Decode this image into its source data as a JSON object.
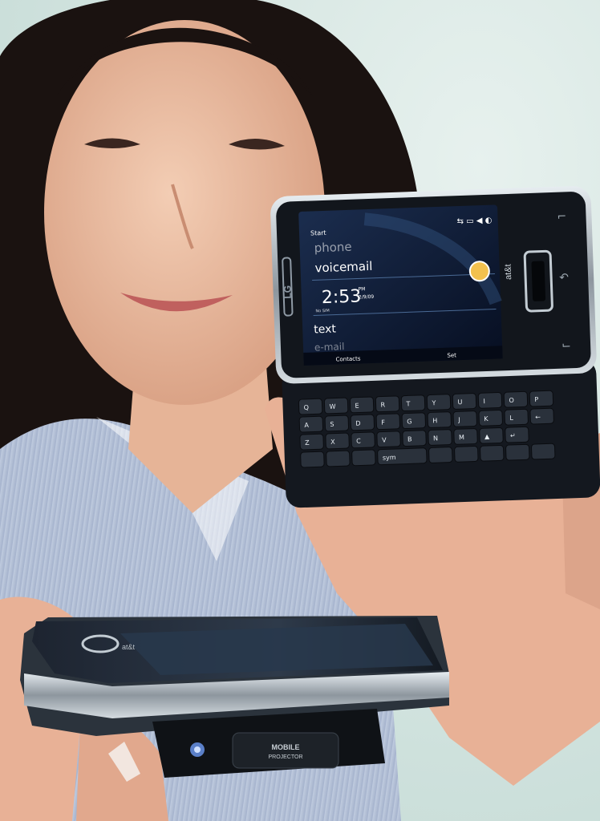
{
  "phone_upper": {
    "brand": "LG",
    "carrier": "at&t",
    "screen": {
      "start_label": "Start",
      "menu_items": [
        "phone",
        "voicemail",
        "text",
        "e-mail"
      ],
      "clock_time": "2:53",
      "clock_ampm": "PM",
      "clock_date": "2/9/09",
      "clock_sub": "No SIM",
      "softkey_left": "Contacts",
      "softkey_right": "Set"
    },
    "keyboard_rows": [
      [
        "Q",
        "W",
        "E",
        "R",
        "T",
        "Y",
        "U",
        "I",
        "O",
        "P"
      ],
      [
        "A",
        "S",
        "D",
        "F",
        "G",
        "H",
        "J",
        "K",
        "L",
        "←"
      ],
      [
        "Z",
        "X",
        "C",
        "V",
        "B",
        "N",
        "M",
        "▲",
        "↵"
      ],
      [
        "",
        "",
        "",
        "sym",
        "",
        "",
        "",
        "",
        ""
      ]
    ]
  },
  "phone_lower": {
    "carrier": "at&t",
    "projector_label_line1": "MOBILE",
    "projector_label_line2": "PROJECTOR"
  },
  "colors": {
    "background": "#d4e6e2",
    "phone_body": "#14181f",
    "screen_bg": "#0c1a33",
    "chrome": "#b9c3cb",
    "key_accent": "#6ab7ff"
  }
}
